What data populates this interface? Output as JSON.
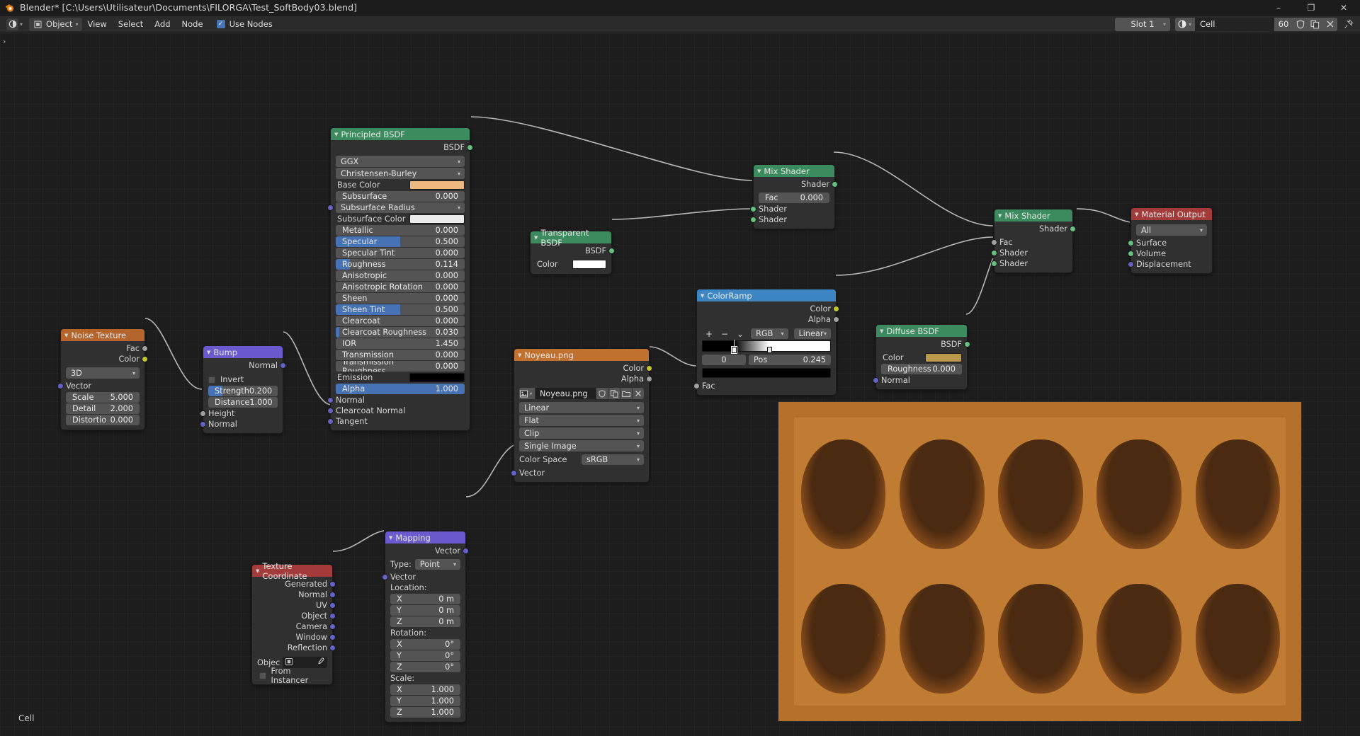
{
  "window": {
    "title": "Blender* [C:\\Users\\Utilisateur\\Documents\\FILORGA\\Test_SoftBody03.blend]",
    "minimize": "–",
    "maximize": "❐",
    "close": "✕"
  },
  "header": {
    "editor_icon": "shader-editor-icon",
    "mode_label": "Object",
    "menus": [
      "View",
      "Select",
      "Add",
      "Node"
    ],
    "use_nodes_label": "Use Nodes",
    "use_nodes_checked": true,
    "slot_label": "Slot 1",
    "material_name": "Cell",
    "users_count": "60",
    "fake_user_icon": "shield-icon",
    "copy_icon": "duplicate-icon",
    "unlink_icon": "x-icon",
    "pin_icon": "pin-icon"
  },
  "canvas": {
    "breadcrumb": "›",
    "footer_label": "Cell"
  },
  "colors": {
    "shader_header": "#3b8b5e",
    "texture_header": "#b4652b",
    "vector_header": "#6a5acd",
    "input_header": "#a33b3b",
    "output_header": "#a33b3b",
    "converter_header": "#3d86c4",
    "base_color_swatch": "#eeb980",
    "subsurface_color_swatch": "#ebebeb",
    "emission_swatch": "#000000",
    "transparent_color_swatch": "#ffffff",
    "diffuse_color_swatch": "#b89a4a",
    "slider_fill": "#4772b3"
  },
  "nodes": {
    "noise_texture": {
      "title": "Noise Texture",
      "outputs": [
        "Fac",
        "Color"
      ],
      "dimension": "3D",
      "vector_label": "Vector",
      "params": [
        {
          "label": "Scale",
          "value": "5.000"
        },
        {
          "label": "Detail",
          "value": "2.000"
        },
        {
          "label": "Distortio",
          "value": "0.000"
        }
      ]
    },
    "bump": {
      "title": "Bump",
      "outputs": [
        "Normal"
      ],
      "invert_label": "Invert",
      "invert_checked": false,
      "params": [
        {
          "label": "Strength",
          "value": "0.200",
          "fill": 20
        },
        {
          "label": "Distance",
          "value": "1.000",
          "fill": 0
        }
      ],
      "inputs": [
        "Height",
        "Normal"
      ]
    },
    "principled_bsdf": {
      "title": "Principled BSDF",
      "output": "BSDF",
      "distribution": "GGX",
      "subsurface_method": "Christensen-Burley",
      "rows": [
        {
          "label": "Base Color",
          "type": "color",
          "color": "#eeb980",
          "socket": "s-color"
        },
        {
          "label": "Subsurface",
          "type": "value",
          "value": "0.000",
          "fill": 0,
          "socket": "s-float"
        },
        {
          "label": "Subsurface Radius",
          "type": "dropdown",
          "socket": "s-vector"
        },
        {
          "label": "Subsurface Color",
          "type": "color",
          "color": "#ebebeb",
          "socket": "s-color"
        },
        {
          "label": "Metallic",
          "type": "value",
          "value": "0.000",
          "fill": 0,
          "socket": "s-float"
        },
        {
          "label": "Specular",
          "type": "value",
          "value": "0.500",
          "fill": 50,
          "socket": "s-float"
        },
        {
          "label": "Specular Tint",
          "type": "value",
          "value": "0.000",
          "fill": 0,
          "socket": "s-float"
        },
        {
          "label": "Roughness",
          "type": "value",
          "value": "0.114",
          "fill": 11,
          "socket": "s-float"
        },
        {
          "label": "Anisotropic",
          "type": "value",
          "value": "0.000",
          "fill": 0,
          "socket": "s-float"
        },
        {
          "label": "Anisotropic Rotation",
          "type": "value",
          "value": "0.000",
          "fill": 0,
          "socket": "s-float"
        },
        {
          "label": "Sheen",
          "type": "value",
          "value": "0.000",
          "fill": 0,
          "socket": "s-float"
        },
        {
          "label": "Sheen Tint",
          "type": "value",
          "value": "0.500",
          "fill": 50,
          "socket": "s-float"
        },
        {
          "label": "Clearcoat",
          "type": "value",
          "value": "0.000",
          "fill": 0,
          "socket": "s-float"
        },
        {
          "label": "Clearcoat Roughness",
          "type": "value",
          "value": "0.030",
          "fill": 3,
          "socket": "s-float"
        },
        {
          "label": "IOR",
          "type": "value",
          "value": "1.450",
          "fill": 0,
          "socket": "s-float"
        },
        {
          "label": "Transmission",
          "type": "value",
          "value": "0.000",
          "fill": 0,
          "socket": "s-float"
        },
        {
          "label": "Transmission Roughness",
          "type": "value",
          "value": "0.000",
          "fill": 0,
          "socket": "s-float"
        },
        {
          "label": "Emission",
          "type": "color",
          "color": "#000000",
          "socket": "s-color"
        },
        {
          "label": "Alpha",
          "type": "value",
          "value": "1.000",
          "fill": 100,
          "socket": "s-float"
        },
        {
          "label": "Normal",
          "type": "plain",
          "socket": "s-vector"
        },
        {
          "label": "Clearcoat Normal",
          "type": "plain",
          "socket": "s-vector"
        },
        {
          "label": "Tangent",
          "type": "plain",
          "socket": "s-vector"
        }
      ]
    },
    "transparent_bsdf": {
      "title": "Transparent BSDF",
      "output": "BSDF",
      "color_label": "Color",
      "color": "#ffffff"
    },
    "mix_shader_1": {
      "title": "Mix Shader",
      "output": "Shader",
      "fac_label": "Fac",
      "fac_value": "0.000",
      "inputs": [
        "Shader",
        "Shader"
      ]
    },
    "mix_shader_2": {
      "title": "Mix Shader",
      "output": "Shader",
      "inputs": [
        "Fac",
        "Shader",
        "Shader"
      ]
    },
    "color_ramp": {
      "title": "ColorRamp",
      "outputs": [
        "Color",
        "Alpha"
      ],
      "add_btn": "+",
      "remove_btn": "−",
      "menu_btn": "⌄",
      "interpolation_mode": "RGB",
      "interpolation": "Linear",
      "index_value": "0",
      "pos_label": "Pos",
      "pos_value": "0.245",
      "selected_color": "#000000",
      "fac_label": "Fac",
      "stops": [
        {
          "pos": 0.245,
          "color": "#000000"
        },
        {
          "pos": 0.52,
          "color": "#ffffff"
        }
      ]
    },
    "image_texture": {
      "title": "Noyeau.png",
      "outputs": [
        "Color",
        "Alpha"
      ],
      "image_name": "Noyeau.png",
      "browse_icon": "image-browse-icon",
      "fake_user_icon": "shield-icon",
      "copy_icon": "duplicate-icon",
      "open_icon": "folder-icon",
      "unlink_icon": "x-icon",
      "interpolation": "Linear",
      "projection": "Flat",
      "extension": "Clip",
      "source": "Single Image",
      "color_space_label": "Color Space",
      "color_space": "sRGB",
      "vector_label": "Vector"
    },
    "mapping": {
      "title": "Mapping",
      "output": "Vector",
      "type_label": "Type:",
      "type_value": "Point",
      "vector_label": "Vector",
      "location_label": "Location:",
      "location": [
        {
          "axis": "X",
          "value": "0 m"
        },
        {
          "axis": "Y",
          "value": "0 m"
        },
        {
          "axis": "Z",
          "value": "0 m"
        }
      ],
      "rotation_label": "Rotation:",
      "rotation": [
        {
          "axis": "X",
          "value": "0°"
        },
        {
          "axis": "Y",
          "value": "0°"
        },
        {
          "axis": "Z",
          "value": "0°"
        }
      ],
      "scale_label": "Scale:",
      "scale": [
        {
          "axis": "X",
          "value": "1.000"
        },
        {
          "axis": "Y",
          "value": "1.000"
        },
        {
          "axis": "Z",
          "value": "1.000"
        }
      ]
    },
    "texture_coordinate": {
      "title": "Texture Coordinate",
      "outputs": [
        "Generated",
        "Normal",
        "UV",
        "Object",
        "Camera",
        "Window",
        "Reflection"
      ],
      "object_label": "Objec",
      "object_value": "",
      "eyedropper_icon": "eyedropper-icon",
      "from_instancer_label": "From Instancer",
      "from_instancer_checked": false
    },
    "diffuse_bsdf": {
      "title": "Diffuse BSDF",
      "output": "BSDF",
      "color_label": "Color",
      "color": "#b89a4a",
      "roughness_label": "Roughness",
      "roughness_value": "0.000",
      "normal_label": "Normal"
    },
    "material_output": {
      "title": "Material Output",
      "target": "All",
      "inputs": [
        "Surface",
        "Volume",
        "Displacement"
      ]
    }
  },
  "preview": {
    "name": "render-preview",
    "border_color": "#b5712b",
    "background_color": "#c07c32",
    "cell_color": "#4a2a10",
    "rows": 2,
    "cols": 5
  }
}
